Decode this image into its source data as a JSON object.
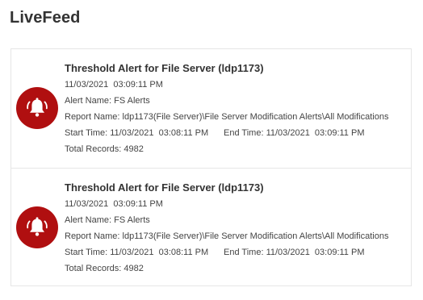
{
  "page": {
    "title": "LiveFeed"
  },
  "colors": {
    "accent": "#b00f10",
    "text": "#333333",
    "border": "#e6e6e6"
  },
  "feed": {
    "items": [
      {
        "icon": "bell-alert-icon",
        "title": "Threshold Alert for File Server (ldp1173)",
        "timestamp": "11/03/2021  03:09:11 PM",
        "alert_name": "Alert Name: FS Alerts",
        "report_name": "Report Name: ldp1173(File Server)\\File Server Modification Alerts\\All Modifications",
        "start_time": "Start Time: 11/03/2021  03:08:11 PM",
        "end_time": "End Time: 11/03/2021  03:09:11 PM",
        "total_records": "Total Records: 4982"
      },
      {
        "icon": "bell-alert-icon",
        "title": "Threshold Alert for File Server (ldp1173)",
        "timestamp": "11/03/2021  03:09:11 PM",
        "alert_name": "Alert Name: FS Alerts",
        "report_name": "Report Name: ldp1173(File Server)\\File Server Modification Alerts\\All Modifications",
        "start_time": "Start Time: 11/03/2021  03:08:11 PM",
        "end_time": "End Time: 11/03/2021  03:09:11 PM",
        "total_records": "Total Records: 4982"
      }
    ]
  }
}
